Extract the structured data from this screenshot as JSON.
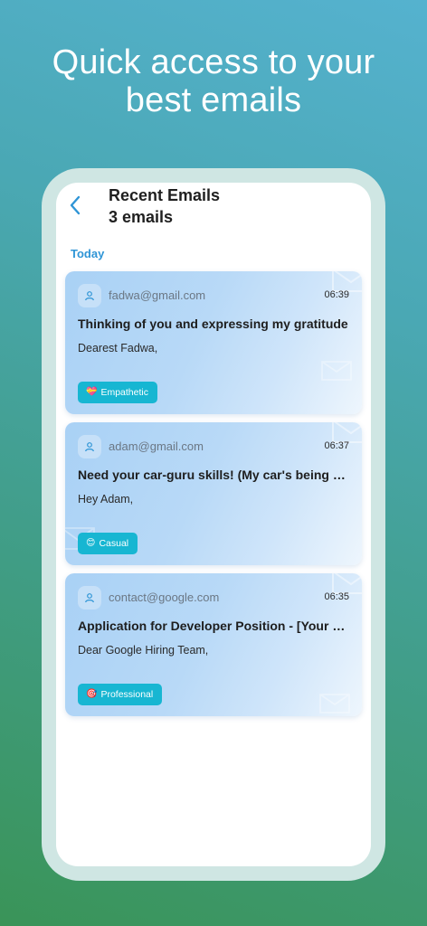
{
  "headline": {
    "line1": "Quick access to your",
    "line2": "best emails"
  },
  "header": {
    "back_icon": "chevron-left-icon",
    "title": "Recent Emails",
    "count": "3 emails"
  },
  "section": {
    "label": "Today"
  },
  "emails": [
    {
      "sender": "fadwa@gmail.com",
      "time": "06:39",
      "subject": "Thinking of you and expressing my gratitude",
      "preview": "Dearest Fadwa,",
      "tone": "Empathetic",
      "tone_icon": "💝"
    },
    {
      "sender": "adam@gmail.com",
      "time": "06:37",
      "subject": "Need your car-guru skills! (My car's being stubborn)",
      "preview": "Hey Adam,",
      "tone": "Casual",
      "tone_icon": "😊"
    },
    {
      "sender": "contact@google.com",
      "time": "06:35",
      "subject": "Application for Developer Position - [Your Name]",
      "preview": "Dear Google Hiring Team,",
      "tone": "Professional",
      "tone_icon": "🎯"
    }
  ],
  "colors": {
    "accent": "#2f95d6",
    "badge": "#17b6d2",
    "frame": "#cfe6e3"
  }
}
